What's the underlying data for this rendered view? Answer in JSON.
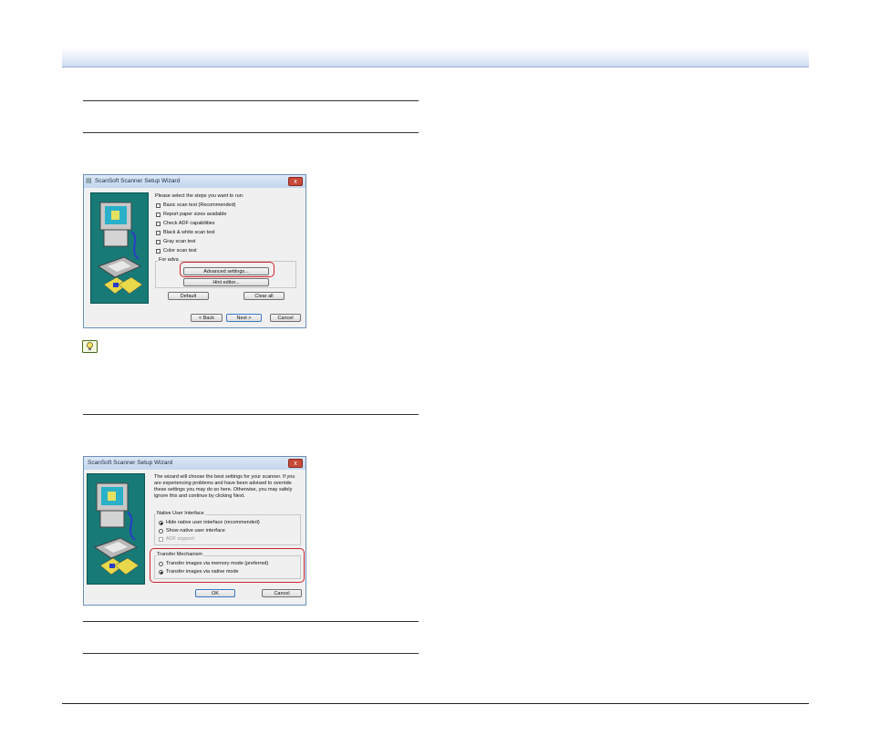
{
  "colors": {
    "highlight": "#d0202a",
    "art_bg": "#177a77",
    "header_blue": "#c9d8f0"
  },
  "dialog1": {
    "title": "ScanSoft Scanner Setup Wizard",
    "prompt": "Please select the steps you want to run:",
    "checks": [
      "Basic scan test (Recommended)",
      "Report paper sizes available",
      "Check ADF capabilities",
      "Black & white scan test",
      "Gray scan test",
      "Color scan test"
    ],
    "group_label": "For adva",
    "advanced_button": "Advanced settings...",
    "hint_button": "Hint editor...",
    "default_button": "Default",
    "clear_all_button": "Clear all",
    "back_button": "< Back",
    "next_button": "Next >",
    "cancel_button": "Cancel",
    "close_glyph": "x"
  },
  "dialog2": {
    "title": "ScanSoft Scanner Setup Wizard",
    "intro_lines": [
      "The wizard will choose the best settings for your scanner. If you",
      "are experiencing problems and have been advised to override",
      "these settings you may do so here. Otherwise, you may safely",
      "ignore this and continue by clicking Next."
    ],
    "native_group": "Native User Interface",
    "native_options": [
      "Hide native user interface (recommended)",
      "Show native user interface"
    ],
    "adf_support": "ADF support",
    "transfer_group": "Transfer Mechanism",
    "transfer_options": [
      "Transfer images via memory mode (preferred)",
      "Transfer images via native mode"
    ],
    "ok_button": "OK",
    "cancel_button": "Cancel",
    "close_glyph": "x"
  }
}
